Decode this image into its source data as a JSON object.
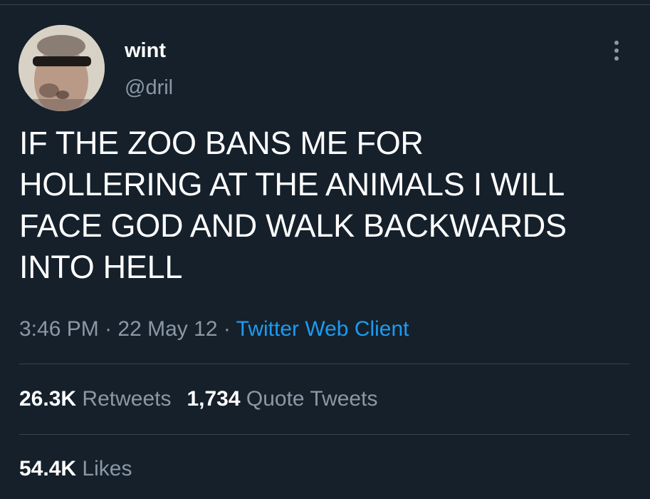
{
  "tweet": {
    "author": {
      "display_name": "wint",
      "handle": "@dril",
      "avatar": "profile-photo-man-with-sunglasses"
    },
    "more_icon": "more-dots-icon",
    "text_lines": [
      "IF THE ZOO BANS ME FOR",
      "HOLLERING AT THE ANIMALS I WILL",
      "FACE GOD AND WALK BACKWARDS",
      "INTO HELL"
    ],
    "time": "3:46 PM",
    "separator": "·",
    "date": "22 May 12",
    "client": "Twitter Web Client",
    "stats": {
      "retweets_count": "26.3K",
      "retweets_label": "Retweets",
      "quotes_count": "1,734",
      "quotes_label": "Quote Tweets",
      "likes_count": "54.4K",
      "likes_label": "Likes"
    }
  },
  "colors": {
    "background": "#15202b",
    "text_primary": "#ffffff",
    "text_secondary": "#8b98a5",
    "link": "#1d9bf0",
    "divider": "#38444d"
  }
}
